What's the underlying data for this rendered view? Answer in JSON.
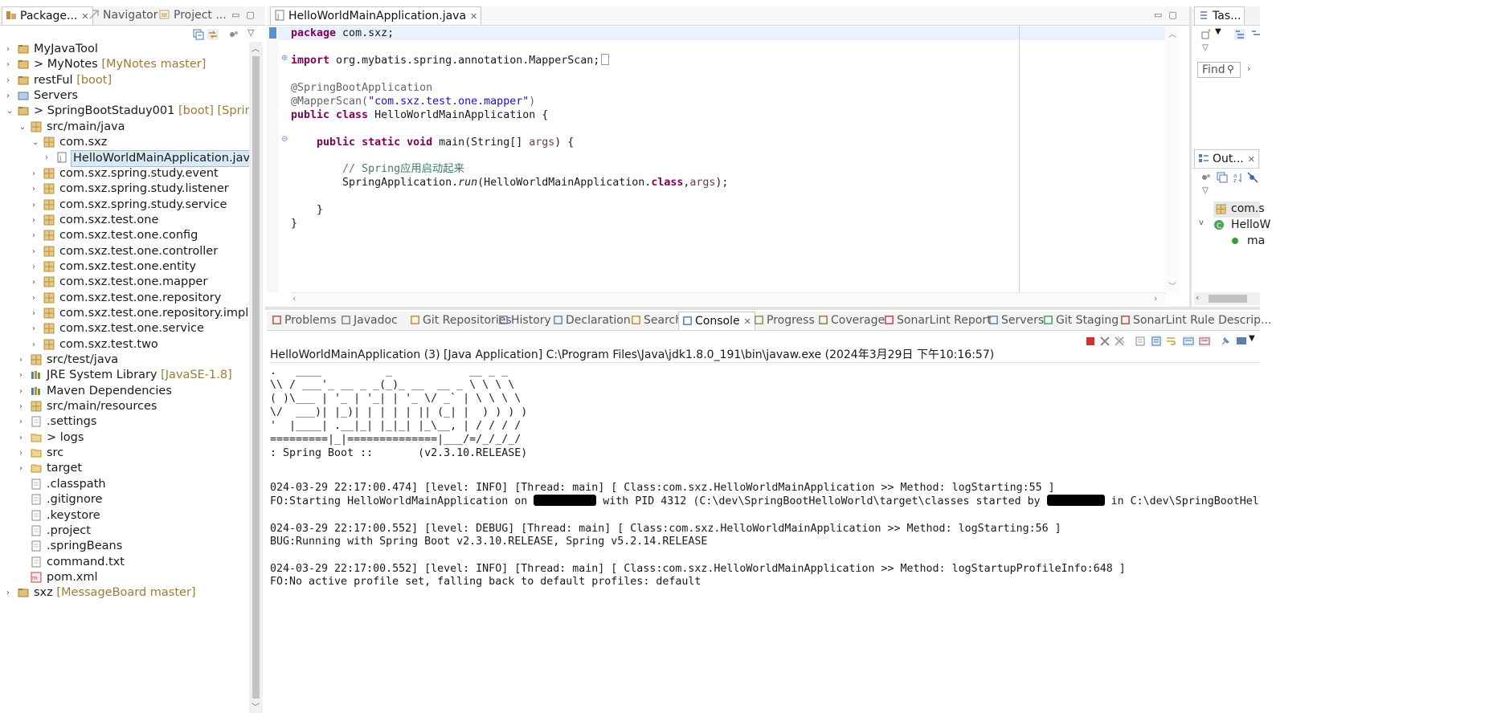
{
  "left_panel": {
    "tabs": [
      {
        "label": "Package...",
        "active": true
      },
      {
        "label": "Navigator",
        "active": false
      },
      {
        "label": "Project ...",
        "active": false
      }
    ],
    "tree": [
      {
        "label": "MyJavaTool",
        "deco": "",
        "depth": 0,
        "twisty": ">"
      },
      {
        "label": "> MyNotes",
        "deco": "[MyNotes master]",
        "depth": 0,
        "twisty": ">"
      },
      {
        "label": "restFul",
        "deco": "[boot]",
        "depth": 0,
        "twisty": ">"
      },
      {
        "label": "Servers",
        "deco": "",
        "depth": 0,
        "twisty": ">"
      },
      {
        "label": "> SpringBootStaduy001",
        "deco": "[boot] [SpringBoot",
        "depth": 0,
        "twisty": "v"
      },
      {
        "label": "src/main/java",
        "deco": "",
        "depth": 1,
        "twisty": "v"
      },
      {
        "label": "com.sxz",
        "deco": "",
        "depth": 2,
        "twisty": "v"
      },
      {
        "label": "HelloWorldMainApplication.java",
        "deco": "",
        "depth": 3,
        "twisty": ">",
        "selected": true
      },
      {
        "label": "com.sxz.spring.study.event",
        "deco": "",
        "depth": 2,
        "twisty": ">"
      },
      {
        "label": "com.sxz.spring.study.listener",
        "deco": "",
        "depth": 2,
        "twisty": ">"
      },
      {
        "label": "com.sxz.spring.study.service",
        "deco": "",
        "depth": 2,
        "twisty": ">"
      },
      {
        "label": "com.sxz.test.one",
        "deco": "",
        "depth": 2,
        "twisty": ">"
      },
      {
        "label": "com.sxz.test.one.config",
        "deco": "",
        "depth": 2,
        "twisty": ">"
      },
      {
        "label": "com.sxz.test.one.controller",
        "deco": "",
        "depth": 2,
        "twisty": ">"
      },
      {
        "label": "com.sxz.test.one.entity",
        "deco": "",
        "depth": 2,
        "twisty": ">"
      },
      {
        "label": "com.sxz.test.one.mapper",
        "deco": "",
        "depth": 2,
        "twisty": ">"
      },
      {
        "label": "com.sxz.test.one.repository",
        "deco": "",
        "depth": 2,
        "twisty": ">"
      },
      {
        "label": "com.sxz.test.one.repository.impl",
        "deco": "",
        "depth": 2,
        "twisty": ">"
      },
      {
        "label": "com.sxz.test.one.service",
        "deco": "",
        "depth": 2,
        "twisty": ">"
      },
      {
        "label": "com.sxz.test.two",
        "deco": "",
        "depth": 2,
        "twisty": ">"
      },
      {
        "label": "src/test/java",
        "deco": "",
        "depth": 1,
        "twisty": ">"
      },
      {
        "label": "JRE System Library",
        "deco": "[JavaSE-1.8]",
        "depth": 1,
        "twisty": ">"
      },
      {
        "label": "Maven Dependencies",
        "deco": "",
        "depth": 1,
        "twisty": ">"
      },
      {
        "label": "src/main/resources",
        "deco": "",
        "depth": 1,
        "twisty": ">"
      },
      {
        "label": ".settings",
        "deco": "",
        "depth": 1,
        "twisty": ">"
      },
      {
        "label": "> logs",
        "deco": "",
        "depth": 1,
        "twisty": ">"
      },
      {
        "label": "src",
        "deco": "",
        "depth": 1,
        "twisty": ">"
      },
      {
        "label": "target",
        "deco": "",
        "depth": 1,
        "twisty": ">"
      },
      {
        "label": ".classpath",
        "deco": "",
        "depth": 1,
        "twisty": ""
      },
      {
        "label": ".gitignore",
        "deco": "",
        "depth": 1,
        "twisty": ""
      },
      {
        "label": ".keystore",
        "deco": "",
        "depth": 1,
        "twisty": ""
      },
      {
        "label": ".project",
        "deco": "",
        "depth": 1,
        "twisty": ""
      },
      {
        "label": ".springBeans",
        "deco": "",
        "depth": 1,
        "twisty": ""
      },
      {
        "label": "command.txt",
        "deco": "",
        "depth": 1,
        "twisty": ""
      },
      {
        "label": "pom.xml",
        "deco": "",
        "depth": 1,
        "twisty": ""
      },
      {
        "label": "sxz",
        "deco": "[MessageBoard master]",
        "depth": 0,
        "twisty": ">"
      }
    ]
  },
  "editor": {
    "tab_label": "HelloWorldMainApplication.java",
    "lines": {
      "l1": {
        "kw": "package",
        "rest": " com.sxz;"
      },
      "l3": {
        "kw": "import",
        "rest": " org.mybatis.spring.annotation.MapperScan;"
      },
      "l5": "@SpringBootApplication",
      "l6a": "@MapperScan(",
      "l6b": "\"com.sxz.test.one.mapper\"",
      "l6c": ")",
      "l7a": "public class",
      "l7b": " HelloWorldMainApplication {",
      "l9a": "    ",
      "l9b": "public static void",
      "l9c": " main(String[] ",
      "l9d": "args",
      "l9e": ") {",
      "l11": "        // Spring应用启动起来",
      "l12a": "        SpringApplication.",
      "l12b": "run",
      "l12c": "(HelloWorldMainApplication.",
      "l12d": "class",
      "l12e": ",",
      "l12f": "args",
      "l12g": ");",
      "l14": "    }",
      "l15": "}"
    }
  },
  "right_top": {
    "tab_label": "Tas...",
    "find_placeholder": "Find"
  },
  "outline": {
    "tab_label": "Out...",
    "items": [
      {
        "label": "com.s"
      },
      {
        "label": "HelloW"
      },
      {
        "label": "ma"
      }
    ]
  },
  "bottom_tabs": [
    {
      "label": "Problems"
    },
    {
      "label": "Javadoc"
    },
    {
      "label": "Git Repositories"
    },
    {
      "label": "History"
    },
    {
      "label": "Declaration"
    },
    {
      "label": "Search"
    },
    {
      "label": "Console",
      "active": true
    },
    {
      "label": "Progress"
    },
    {
      "label": "Coverage"
    },
    {
      "label": "SonarLint Report"
    },
    {
      "label": "Servers"
    },
    {
      "label": "Git Staging"
    },
    {
      "label": "SonarLint Rule Descrip..."
    }
  ],
  "console": {
    "title": "HelloWorldMainApplication (3) [Java Application] C:\\Program Files\\Java\\jdk1.8.0_191\\bin\\javaw.exe  (2024年3月29日 下午10:16:57)",
    "banner": [
      ".   ____          _            __ _ _",
      "\\\\ / ___'_ __ _ _(_)_ __  __ _ \\ \\ \\ \\",
      "( )\\___ | '_ | '_| | '_ \\/ _` | \\ \\ \\ \\",
      "\\/  ___)| |_)| | | | | || (_| |  ) ) ) )",
      "'  |____| .__|_| |_|_| |_\\__, | / / / /",
      "=========|_|==============|___/=/_/_/_/",
      ": Spring Boot ::       (v2.3.10.RELEASE)"
    ],
    "log1": "024-03-29 22:17:00.474] [level: INFO] [Thread: main] [ Class:com.sxz.HelloWorldMainApplication >> Method: logStarting:55 ]",
    "log2a": "FO:Starting HelloWorldMainApplication on ",
    "log2b": " with PID 4312 (C:\\dev\\SpringBootHelloWorld\\target\\classes started by ",
    "log2c": " in C:\\dev\\SpringBootHelloWorld)",
    "log3": "024-03-29 22:17:00.552] [level: DEBUG] [Thread: main] [ Class:com.sxz.HelloWorldMainApplication >> Method: logStarting:56 ]",
    "log4": "BUG:Running with Spring Boot v2.3.10.RELEASE, Spring v5.2.14.RELEASE",
    "log5": "024-03-29 22:17:00.552] [level: INFO] [Thread: main] [ Class:com.sxz.HelloWorldMainApplication >> Method: logStartupProfileInfo:648 ]",
    "log6": "FO:No active profile set, falling back to default profiles: default"
  },
  "colors": {
    "keyword": "#7f0055",
    "string": "#2a00ff",
    "comment": "#3f7f5f",
    "annotation": "#646464",
    "decoration": "#a07b32",
    "selection": "#d9e8f6"
  }
}
